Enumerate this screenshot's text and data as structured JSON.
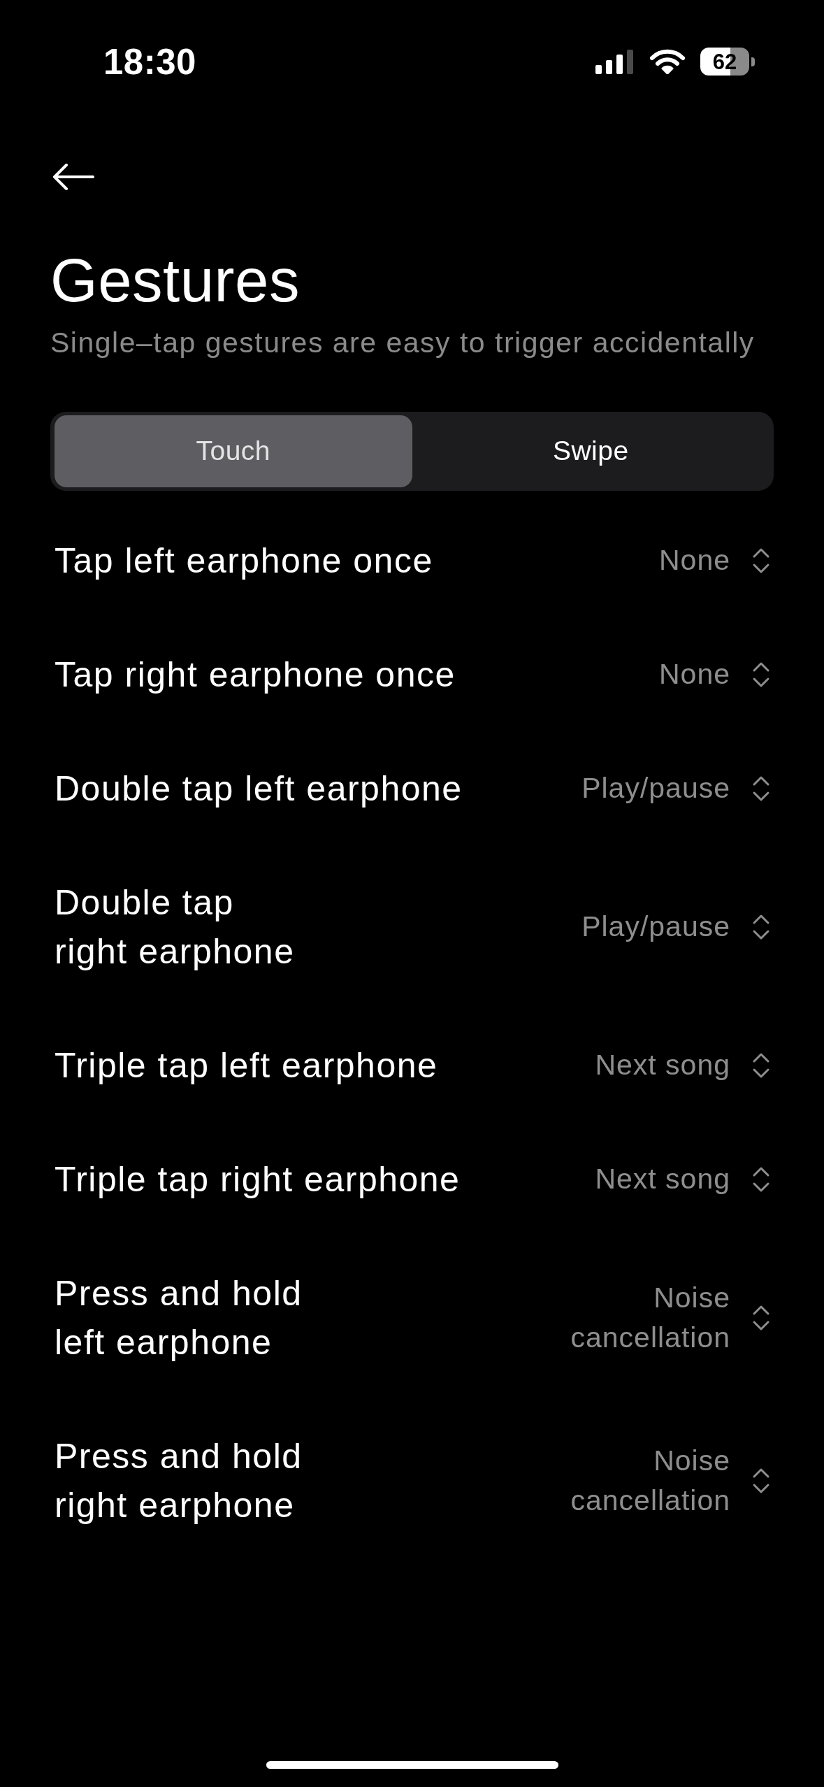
{
  "status_bar": {
    "time": "18:30",
    "battery": "62"
  },
  "header": {
    "title": "Gestures",
    "subtitle": "Single–tap gestures are easy to trigger accidentally"
  },
  "tabs": [
    {
      "label": "Touch",
      "selected": true
    },
    {
      "label": "Swipe",
      "selected": false
    }
  ],
  "gestures": [
    {
      "label": "Tap left earphone once",
      "value": "None"
    },
    {
      "label": "Tap right earphone once",
      "value": "None"
    },
    {
      "label": "Double tap left earphone",
      "value": "Play/pause"
    },
    {
      "label": "Double tap right earphone",
      "value": "Play/pause"
    },
    {
      "label": "Triple tap left earphone",
      "value": "Next song"
    },
    {
      "label": "Triple tap right earphone",
      "value": "Next song"
    },
    {
      "label": "Press and hold left earphone",
      "value": "Noise cancellation"
    },
    {
      "label": "Press and hold right earphone",
      "value": "Noise cancellation"
    }
  ]
}
